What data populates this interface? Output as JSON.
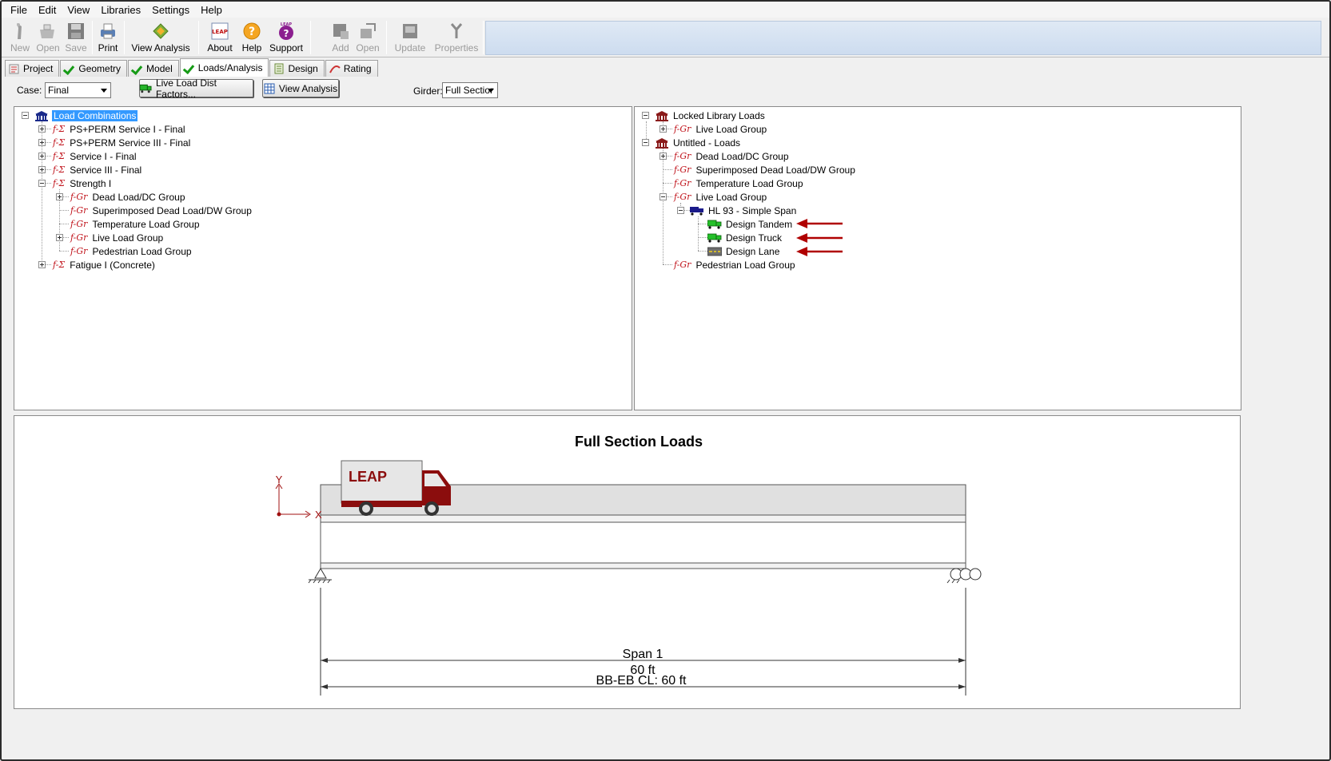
{
  "menu": [
    "File",
    "Edit",
    "View",
    "Libraries",
    "Settings",
    "Help"
  ],
  "toolbar": {
    "new": "New",
    "open": "Open",
    "save": "Save",
    "print": "Print",
    "view_analysis": "View Analysis",
    "about": "About",
    "help": "Help",
    "support": "Support",
    "add": "Add",
    "open2": "Open",
    "update": "Update",
    "properties": "Properties",
    "about_logo": "LEAP",
    "support_logo": "LEAP"
  },
  "tabs": [
    {
      "label": "Project",
      "checked": false
    },
    {
      "label": "Geometry",
      "checked": true
    },
    {
      "label": "Model",
      "checked": true
    },
    {
      "label": "Loads/Analysis",
      "checked": true
    },
    {
      "label": "Design",
      "checked": false
    },
    {
      "label": "Rating",
      "checked": false
    }
  ],
  "options": {
    "case_label": "Case:",
    "case_value": "Final",
    "live_load_button": "Live Load Dist Factors...",
    "view_analysis_button": "View Analysis",
    "girder_label": "Girder:",
    "girder_value": "Full Sectior"
  },
  "left_tree": {
    "root": "Load Combinations",
    "sig": "f-Σ",
    "grp": "f-Gr",
    "items": [
      "PS+PERM Service I - Final",
      "PS+PERM Service III - Final",
      "Service I - Final",
      "Service III - Final",
      "Strength I",
      "Fatigue I (Concrete)"
    ],
    "strength_children": [
      "Dead Load/DC Group",
      "Superimposed Dead Load/DW Group",
      "Temperature Load Group",
      "Live Load Group",
      "Pedestrian Load Group"
    ]
  },
  "right_tree": {
    "locked": "Locked Library Loads",
    "locked_child": "Live Load Group",
    "untitled": "Untitled - Loads",
    "untitled_children": [
      "Dead Load/DC Group",
      "Superimposed Dead Load/DW Group",
      "Temperature Load Group",
      "Live Load Group",
      "Pedestrian Load Group"
    ],
    "hl93": "HL 93 - Simple Span",
    "hl93_children": [
      "Design Tandem",
      "Design Truck",
      "Design Lane"
    ]
  },
  "drawing": {
    "title": "Full Section Loads",
    "truck_label": "LEAP",
    "axis_y": "Y",
    "axis_x": "X",
    "span_label": "Span 1",
    "span_length": "60 ft",
    "bb_eb": "BB-EB CL: 60 ft"
  },
  "colors": {
    "selection": "#3399ff",
    "group_red": "#c0131b",
    "arrow_red": "#b00000",
    "truck_red": "#8b0d0d",
    "check_green": "#169b16"
  }
}
